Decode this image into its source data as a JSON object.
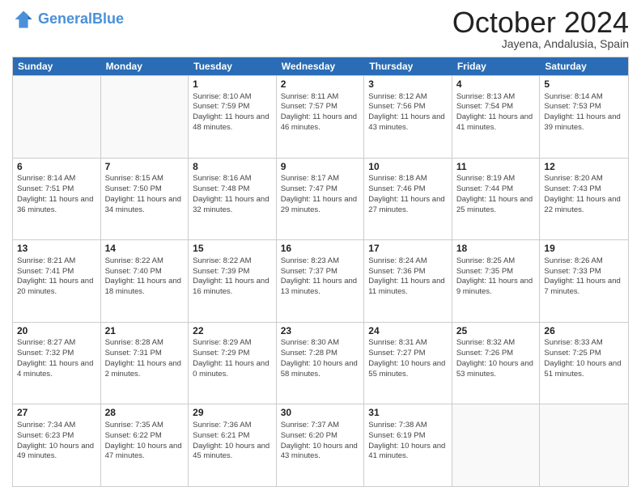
{
  "header": {
    "logo_general": "General",
    "logo_blue": "Blue",
    "month": "October 2024",
    "location": "Jayena, Andalusia, Spain"
  },
  "days_of_week": [
    "Sunday",
    "Monday",
    "Tuesday",
    "Wednesday",
    "Thursday",
    "Friday",
    "Saturday"
  ],
  "weeks": [
    [
      {
        "day": "",
        "info": ""
      },
      {
        "day": "",
        "info": ""
      },
      {
        "day": "1",
        "info": "Sunrise: 8:10 AM\nSunset: 7:59 PM\nDaylight: 11 hours and 48 minutes."
      },
      {
        "day": "2",
        "info": "Sunrise: 8:11 AM\nSunset: 7:57 PM\nDaylight: 11 hours and 46 minutes."
      },
      {
        "day": "3",
        "info": "Sunrise: 8:12 AM\nSunset: 7:56 PM\nDaylight: 11 hours and 43 minutes."
      },
      {
        "day": "4",
        "info": "Sunrise: 8:13 AM\nSunset: 7:54 PM\nDaylight: 11 hours and 41 minutes."
      },
      {
        "day": "5",
        "info": "Sunrise: 8:14 AM\nSunset: 7:53 PM\nDaylight: 11 hours and 39 minutes."
      }
    ],
    [
      {
        "day": "6",
        "info": "Sunrise: 8:14 AM\nSunset: 7:51 PM\nDaylight: 11 hours and 36 minutes."
      },
      {
        "day": "7",
        "info": "Sunrise: 8:15 AM\nSunset: 7:50 PM\nDaylight: 11 hours and 34 minutes."
      },
      {
        "day": "8",
        "info": "Sunrise: 8:16 AM\nSunset: 7:48 PM\nDaylight: 11 hours and 32 minutes."
      },
      {
        "day": "9",
        "info": "Sunrise: 8:17 AM\nSunset: 7:47 PM\nDaylight: 11 hours and 29 minutes."
      },
      {
        "day": "10",
        "info": "Sunrise: 8:18 AM\nSunset: 7:46 PM\nDaylight: 11 hours and 27 minutes."
      },
      {
        "day": "11",
        "info": "Sunrise: 8:19 AM\nSunset: 7:44 PM\nDaylight: 11 hours and 25 minutes."
      },
      {
        "day": "12",
        "info": "Sunrise: 8:20 AM\nSunset: 7:43 PM\nDaylight: 11 hours and 22 minutes."
      }
    ],
    [
      {
        "day": "13",
        "info": "Sunrise: 8:21 AM\nSunset: 7:41 PM\nDaylight: 11 hours and 20 minutes."
      },
      {
        "day": "14",
        "info": "Sunrise: 8:22 AM\nSunset: 7:40 PM\nDaylight: 11 hours and 18 minutes."
      },
      {
        "day": "15",
        "info": "Sunrise: 8:22 AM\nSunset: 7:39 PM\nDaylight: 11 hours and 16 minutes."
      },
      {
        "day": "16",
        "info": "Sunrise: 8:23 AM\nSunset: 7:37 PM\nDaylight: 11 hours and 13 minutes."
      },
      {
        "day": "17",
        "info": "Sunrise: 8:24 AM\nSunset: 7:36 PM\nDaylight: 11 hours and 11 minutes."
      },
      {
        "day": "18",
        "info": "Sunrise: 8:25 AM\nSunset: 7:35 PM\nDaylight: 11 hours and 9 minutes."
      },
      {
        "day": "19",
        "info": "Sunrise: 8:26 AM\nSunset: 7:33 PM\nDaylight: 11 hours and 7 minutes."
      }
    ],
    [
      {
        "day": "20",
        "info": "Sunrise: 8:27 AM\nSunset: 7:32 PM\nDaylight: 11 hours and 4 minutes."
      },
      {
        "day": "21",
        "info": "Sunrise: 8:28 AM\nSunset: 7:31 PM\nDaylight: 11 hours and 2 minutes."
      },
      {
        "day": "22",
        "info": "Sunrise: 8:29 AM\nSunset: 7:29 PM\nDaylight: 11 hours and 0 minutes."
      },
      {
        "day": "23",
        "info": "Sunrise: 8:30 AM\nSunset: 7:28 PM\nDaylight: 10 hours and 58 minutes."
      },
      {
        "day": "24",
        "info": "Sunrise: 8:31 AM\nSunset: 7:27 PM\nDaylight: 10 hours and 55 minutes."
      },
      {
        "day": "25",
        "info": "Sunrise: 8:32 AM\nSunset: 7:26 PM\nDaylight: 10 hours and 53 minutes."
      },
      {
        "day": "26",
        "info": "Sunrise: 8:33 AM\nSunset: 7:25 PM\nDaylight: 10 hours and 51 minutes."
      }
    ],
    [
      {
        "day": "27",
        "info": "Sunrise: 7:34 AM\nSunset: 6:23 PM\nDaylight: 10 hours and 49 minutes."
      },
      {
        "day": "28",
        "info": "Sunrise: 7:35 AM\nSunset: 6:22 PM\nDaylight: 10 hours and 47 minutes."
      },
      {
        "day": "29",
        "info": "Sunrise: 7:36 AM\nSunset: 6:21 PM\nDaylight: 10 hours and 45 minutes."
      },
      {
        "day": "30",
        "info": "Sunrise: 7:37 AM\nSunset: 6:20 PM\nDaylight: 10 hours and 43 minutes."
      },
      {
        "day": "31",
        "info": "Sunrise: 7:38 AM\nSunset: 6:19 PM\nDaylight: 10 hours and 41 minutes."
      },
      {
        "day": "",
        "info": ""
      },
      {
        "day": "",
        "info": ""
      }
    ]
  ]
}
